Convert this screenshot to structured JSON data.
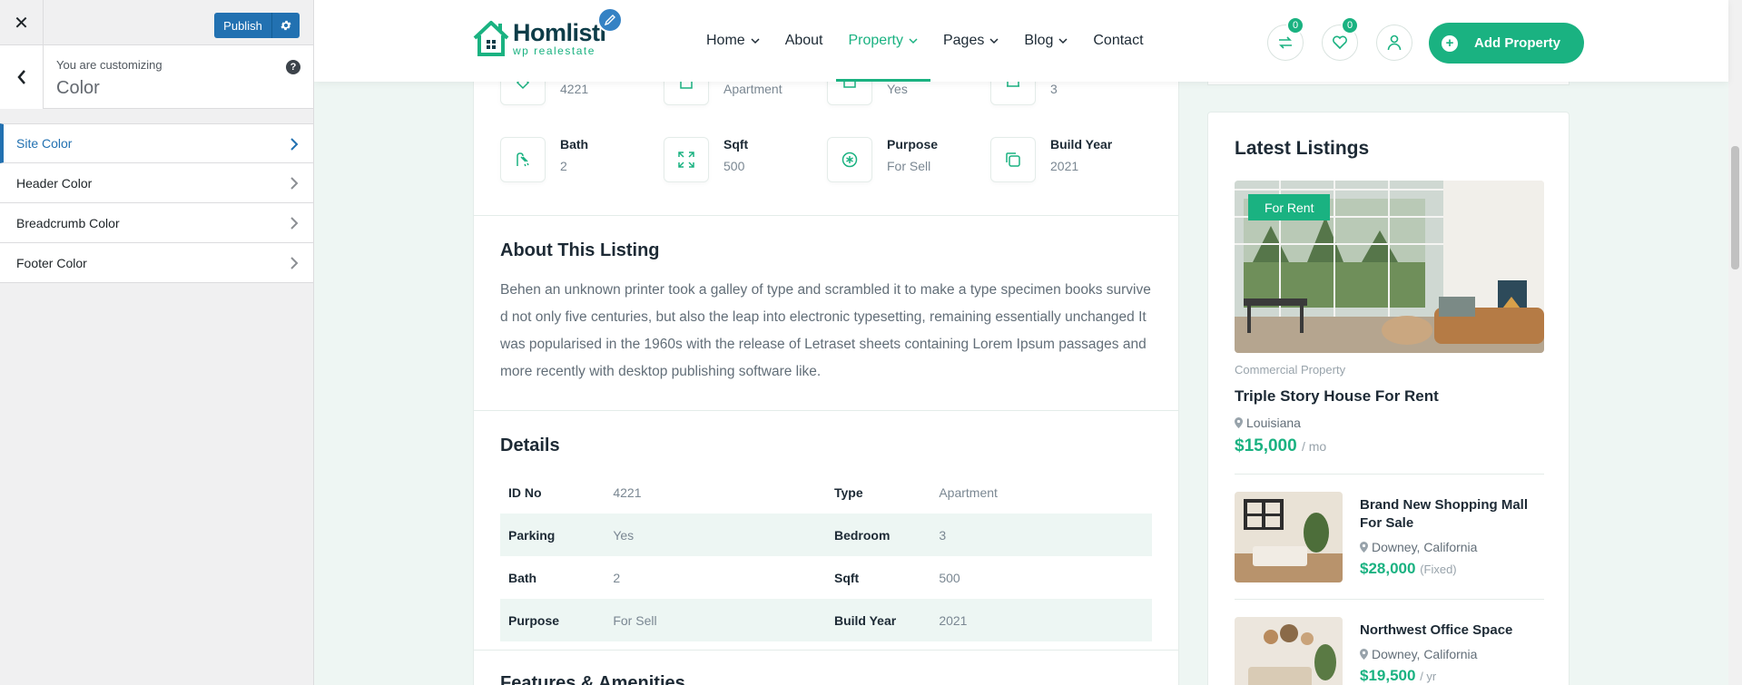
{
  "customizer": {
    "publish_label": "Publish",
    "customizing_label": "You are customizing",
    "section_title": "Color",
    "help_label": "?",
    "menu": [
      {
        "label": "Site Color"
      },
      {
        "label": "Header Color"
      },
      {
        "label": "Breadcrumb Color"
      },
      {
        "label": "Footer Color"
      }
    ]
  },
  "site": {
    "logo_name": "Homlisti",
    "logo_tagline": "wp realestate",
    "nav": [
      {
        "label": "Home",
        "dropdown": true
      },
      {
        "label": "About",
        "dropdown": false
      },
      {
        "label": "Property",
        "dropdown": true,
        "active": true
      },
      {
        "label": "Pages",
        "dropdown": true
      },
      {
        "label": "Blog",
        "dropdown": true
      },
      {
        "label": "Contact",
        "dropdown": false
      }
    ],
    "compare_count": "0",
    "wishlist_count": "0",
    "add_property_label": "Add Property",
    "brand_color": "#1ab281"
  },
  "listing": {
    "features_row1": [
      {
        "label": "",
        "value": "4221",
        "icon": "id-icon"
      },
      {
        "label": "",
        "value": "Apartment",
        "icon": "building-icon"
      },
      {
        "label": "",
        "value": "Yes",
        "icon": "parking-icon"
      },
      {
        "label": "",
        "value": "3",
        "icon": "bed-icon"
      }
    ],
    "features_row2": [
      {
        "label": "Bath",
        "value": "2",
        "icon": "shower-icon"
      },
      {
        "label": "Sqft",
        "value": "500",
        "icon": "expand-icon"
      },
      {
        "label": "Purpose",
        "value": "For Sell",
        "icon": "purpose-icon"
      },
      {
        "label": "Build Year",
        "value": "2021",
        "icon": "copy-icon"
      }
    ],
    "about_title": "About This Listing",
    "about_text": "Behen an unknown printer took a galley of type and scrambled it to make a type specimen books survive d not only five centuries, but also the leap into electronic typesetting, remaining essentially unchanged It was popularised in the 1960s with the release of Letraset sheets containing Lorem Ipsum passages and more recently with desktop publishing software like.",
    "details_title": "Details",
    "details": [
      {
        "k1": "ID No",
        "v1": "4221",
        "k2": "Type",
        "v2": "Apartment"
      },
      {
        "k1": "Parking",
        "v1": "Yes",
        "k2": "Bedroom",
        "v2": "3"
      },
      {
        "k1": "Bath",
        "v1": "2",
        "k2": "Sqft",
        "v2": "500"
      },
      {
        "k1": "Purpose",
        "v1": "For Sell",
        "k2": "Build Year",
        "v2": "2021"
      }
    ],
    "features_title": "Features & Amenities"
  },
  "latest": {
    "title": "Latest Listings",
    "featured": {
      "badge": "For Rent",
      "category": "Commercial Property",
      "title": "Triple Story House For Rent",
      "location": "Louisiana",
      "price": "$15,000",
      "period": "/ mo"
    },
    "items": [
      {
        "title": "Brand New Shopping Mall For Sale",
        "location": "Downey, California",
        "price": "$28,000",
        "period": "(Fixed)"
      },
      {
        "title": "Northwest Office Space",
        "location": "Downey, California",
        "price": "$19,500",
        "period": "/ yr"
      }
    ]
  }
}
